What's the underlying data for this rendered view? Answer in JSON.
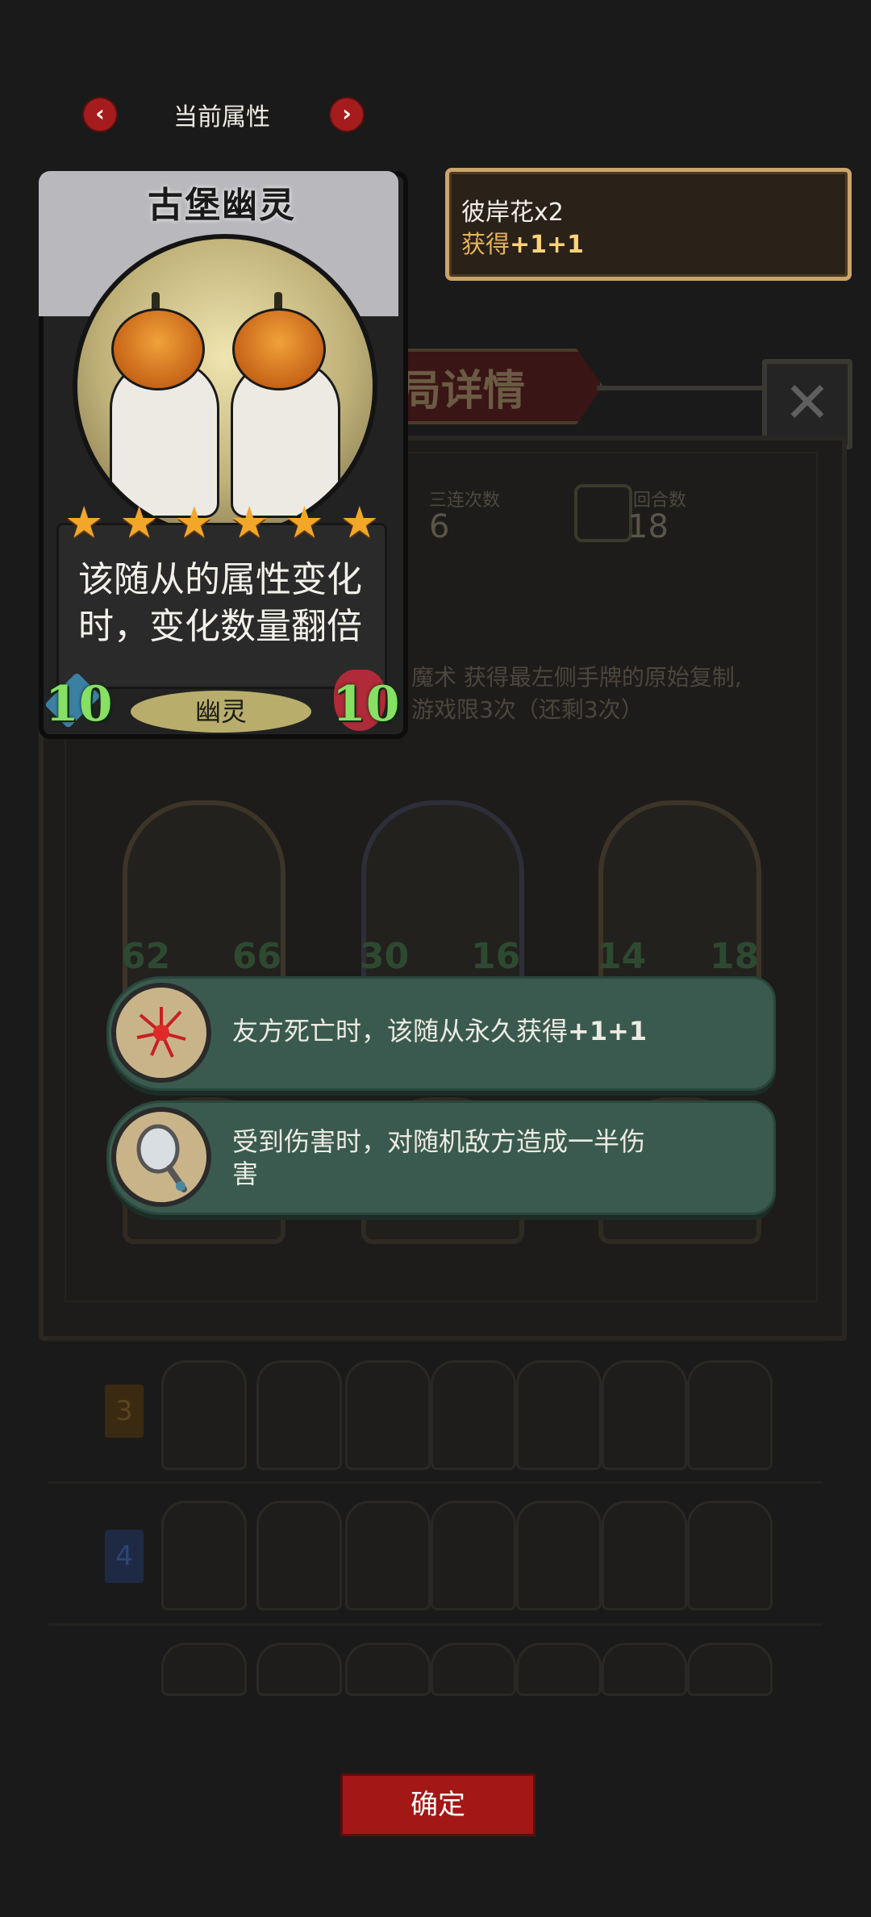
{
  "nav": {
    "title": "当前属性",
    "prev_icon": "chevron-left-icon",
    "next_icon": "chevron-right-icon"
  },
  "card": {
    "name": "古堡幽灵",
    "stars": 6,
    "description": "该随从的属性变化时，变化数量翻倍",
    "attack": "10",
    "health": "10",
    "tribe": "幽灵"
  },
  "reward": {
    "item": "彼岸花x2",
    "gain_prefix": "获得",
    "gain_value": "+1+1"
  },
  "abilities": [
    {
      "icon": "red-spider-lily-icon",
      "text_prefix": "友方死亡时，该随从永久获得",
      "text_bold": "+1+1"
    },
    {
      "icon": "hand-mirror-icon",
      "text_prefix": "受到伤害时，对随机敌方造成一半伤害",
      "text_bold": ""
    }
  ],
  "background": {
    "panel_title": "局详情",
    "stat1_label": "三连次数",
    "stat1_value": "6",
    "stat2_label": "回合数",
    "stat2_value": "18",
    "blurb_line1": "魔术 获得最左侧手牌的原始复制,",
    "blurb_line2": "游戏限3次（还剩3次）",
    "units": [
      {
        "attack": "62",
        "health": "66"
      },
      {
        "attack": "30",
        "health": "16"
      },
      {
        "attack": "14",
        "health": "18"
      }
    ],
    "row_badges": [
      "3",
      "4"
    ]
  },
  "confirm_label": "确定",
  "colors": {
    "accent_red": "#a31717",
    "panel_green": "#3a5a4f",
    "stat_green": "#86e063",
    "star_gold": "#f2a72a",
    "reward_border": "#c9a46b"
  }
}
